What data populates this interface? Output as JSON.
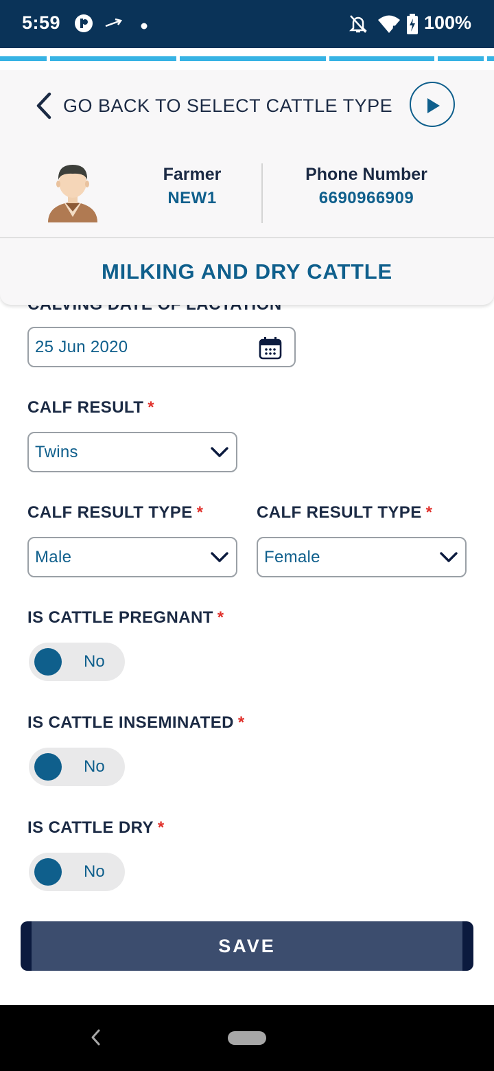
{
  "status_bar": {
    "time": "5:59",
    "battery": "100%",
    "icons": [
      "app-notification-icon",
      "plane-arrow-icon",
      "dot-icon",
      "bell-off-icon",
      "wifi-icon",
      "battery-charging-icon"
    ]
  },
  "header": {
    "back_label": "GO BACK TO SELECT CATTLE TYPE",
    "farmer_label": "Farmer",
    "farmer_value": "NEW1",
    "phone_label": "Phone Number",
    "phone_value": "6690966909",
    "section_title": "MILKING AND DRY CATTLE"
  },
  "form": {
    "clipped_label": "CALVING DATE OF LACTATION",
    "date_value": "25 Jun 2020",
    "calf_result": {
      "label": "CALF RESULT",
      "required": "*",
      "value": "Twins"
    },
    "calf_result_type_1": {
      "label": "CALF RESULT TYPE",
      "required": "*",
      "value": "Male"
    },
    "calf_result_type_2": {
      "label": "CALF RESULT TYPE",
      "required": "*",
      "value": "Female"
    },
    "is_pregnant": {
      "label": "IS CATTLE PREGNANT",
      "required": "*",
      "value": "No"
    },
    "is_inseminated": {
      "label": "IS CATTLE INSEMINATED",
      "required": "*",
      "value": "No"
    },
    "is_dry": {
      "label": "IS CATTLE DRY",
      "required": "*",
      "value": "No"
    },
    "save_label": "SAVE"
  },
  "colors": {
    "status_bar": "#0a3358",
    "accent": "#0f5f8c",
    "progress": "#37b3e4",
    "required": "#e0302b",
    "save_button": "#3c4d6e"
  }
}
